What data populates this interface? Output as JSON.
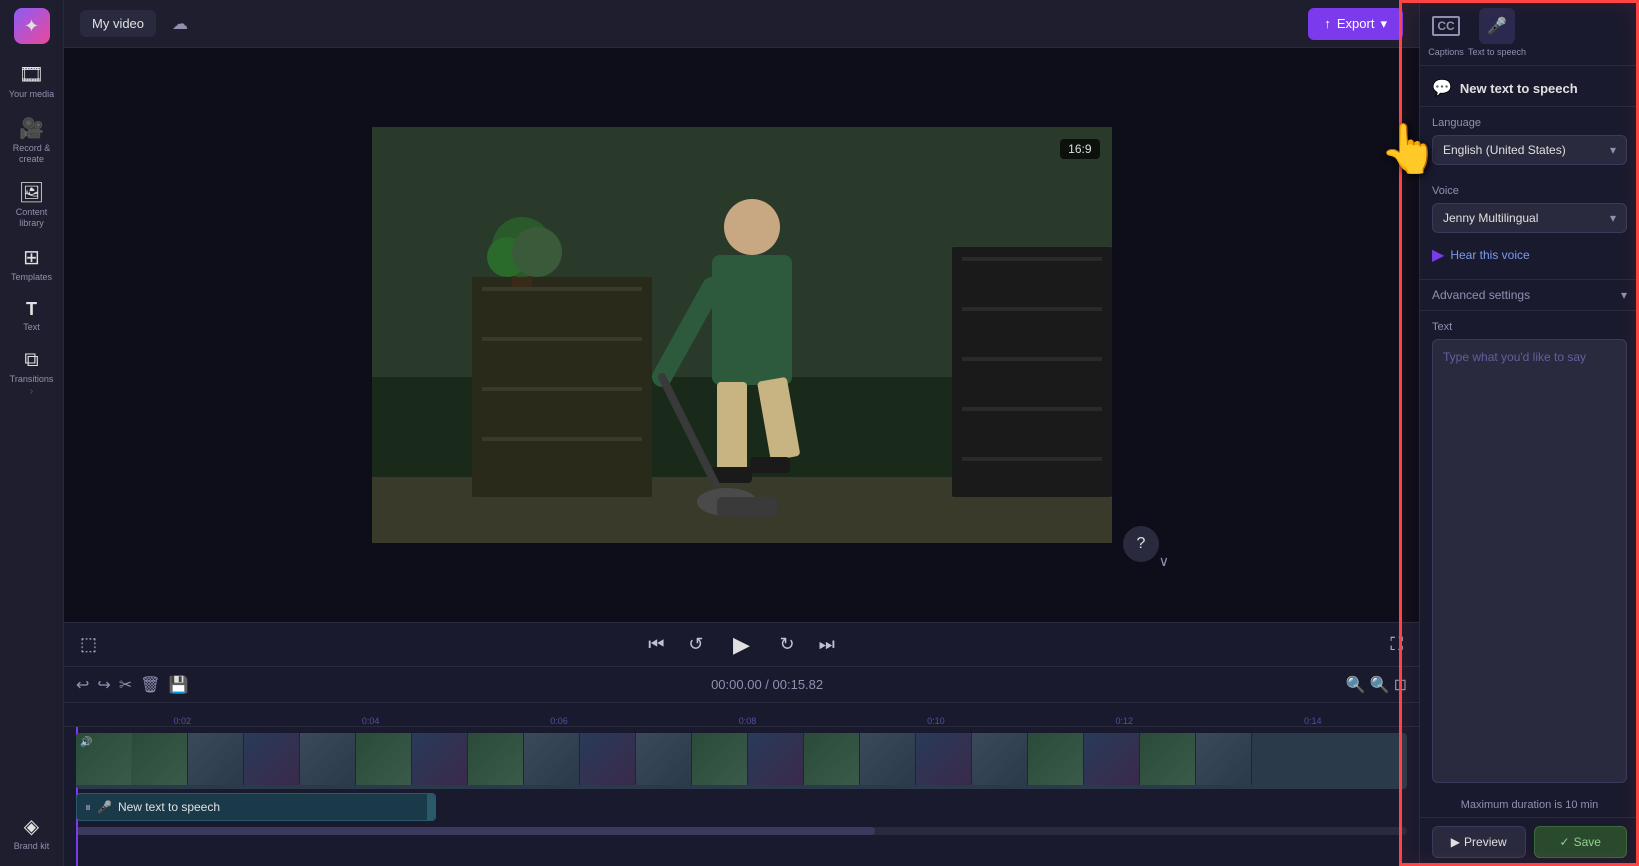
{
  "app": {
    "logo": "✦",
    "title": "My video"
  },
  "topbar": {
    "title": "My video",
    "export_label": "Export",
    "export_icon": "↑"
  },
  "sidebar": {
    "items": [
      {
        "id": "your-media",
        "icon": "🎞",
        "label": "Your media"
      },
      {
        "id": "record",
        "icon": "🎥",
        "label": "Record & create"
      },
      {
        "id": "content-library",
        "icon": "🖼",
        "label": "Content library"
      },
      {
        "id": "templates",
        "icon": "⊞",
        "label": "Templates"
      },
      {
        "id": "text",
        "icon": "T",
        "label": "Text"
      },
      {
        "id": "transitions",
        "icon": "⧉",
        "label": "Transitions"
      },
      {
        "id": "brand",
        "icon": "◈",
        "label": "Brand kit"
      }
    ]
  },
  "preview": {
    "aspect_ratio": "16:9",
    "time_current": "00:00.00",
    "time_total": "00:15.82"
  },
  "timeline": {
    "time_display": "00:00.00 / 00:15.82",
    "ruler_marks": [
      "0:02",
      "0:04",
      "0:06",
      "0:08",
      "0:10",
      "0:12",
      "0:14"
    ],
    "tts_track_label": "New text to speech"
  },
  "right_panel": {
    "tabs": [
      {
        "id": "captions",
        "icon": "CC",
        "label": "Captions"
      },
      {
        "id": "tts",
        "icon": "🎤",
        "label": "Text to speech"
      }
    ],
    "tts": {
      "panel_title": "New text to speech",
      "panel_icon": "💬",
      "language_label": "Language",
      "language_value": "English (United States)",
      "voice_label": "Voice",
      "voice_value": "Jenny Multilingual",
      "hear_voice_label": "Hear this voice",
      "advanced_label": "Advanced settings",
      "text_label": "Text",
      "text_placeholder": "Type what you'd like to say",
      "duration_note": "Maximum duration is 10 min",
      "preview_label": "Preview",
      "save_label": "Save"
    }
  }
}
